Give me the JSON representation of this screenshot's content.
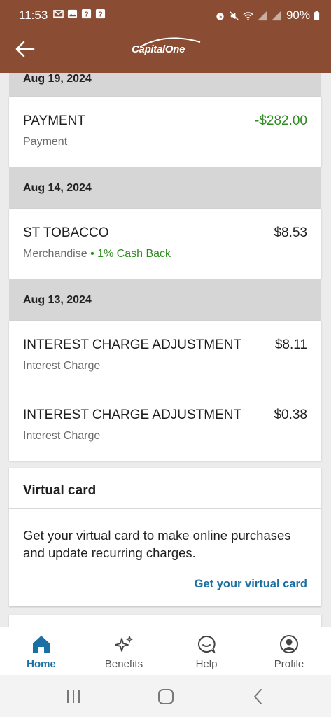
{
  "status_bar": {
    "time": "11:53",
    "battery": "90%",
    "left_icons": [
      "gmail-icon",
      "gallery-icon",
      "unknown-notification-icon",
      "unknown-notification-icon"
    ],
    "right_icons": [
      "alarm-icon",
      "mute-icon",
      "wifi-icon",
      "signal-icon",
      "signal-icon",
      "battery-icon"
    ]
  },
  "header": {
    "brand": "CapitalOne",
    "background_color": "#8a4d33"
  },
  "transactions": [
    {
      "date": "Aug 19, 2024",
      "items": [
        {
          "title": "PAYMENT",
          "category": "Payment",
          "cashback": "",
          "amount": "-$282.00",
          "amount_color": "#2e8b1f"
        }
      ]
    },
    {
      "date": "Aug 14, 2024",
      "items": [
        {
          "title": "ST TOBACCO",
          "category": "Merchandise",
          "cashback": "1% Cash Back",
          "amount": "$8.53"
        }
      ]
    },
    {
      "date": "Aug 13, 2024",
      "items": [
        {
          "title": "INTEREST CHARGE ADJUSTMENT",
          "category": "Interest Charge",
          "amount": "$8.11"
        },
        {
          "title": "INTEREST CHARGE ADJUSTMENT",
          "category": "Interest Charge",
          "amount": "$0.38"
        }
      ]
    }
  ],
  "virtual_card": {
    "title": "Virtual card",
    "body": "Get your virtual card to make online purchases and update recurring charges.",
    "link": "Get your virtual card"
  },
  "bottom_nav": {
    "items": [
      {
        "label": "Home",
        "icon": "home-icon",
        "active": true
      },
      {
        "label": "Benefits",
        "icon": "sparkle-icon",
        "active": false
      },
      {
        "label": "Help",
        "icon": "chat-bubble-icon",
        "active": false
      },
      {
        "label": "Profile",
        "icon": "profile-icon",
        "active": false
      }
    ]
  },
  "colors": {
    "accent": "#1a6fa3",
    "positive": "#2e8b1f",
    "date_band": "#d6d6d6"
  }
}
